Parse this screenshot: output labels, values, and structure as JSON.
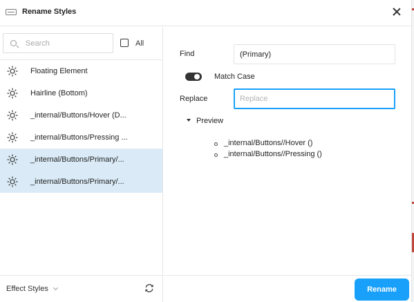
{
  "header": {
    "title": "Rename Styles",
    "icon": "styles-icon"
  },
  "search": {
    "placeholder": "Search",
    "value": ""
  },
  "filter": {
    "all_label": "All",
    "all_checked": false
  },
  "style_list": {
    "items": [
      {
        "label": "Floating Element",
        "icon": "effect-sun-icon",
        "selected": false
      },
      {
        "label": "Hairline (Bottom)",
        "icon": "effect-sun-icon",
        "selected": false
      },
      {
        "label": "_internal/Buttons/Hover (D...",
        "icon": "effect-sun-icon",
        "selected": false
      },
      {
        "label": "_internal/Buttons/Pressing ...",
        "icon": "effect-sun-icon",
        "selected": false
      },
      {
        "label": "_internal/Buttons/Primary/...",
        "icon": "effect-sun-icon",
        "selected": true
      },
      {
        "label": "_internal/Buttons/Primary/...",
        "icon": "effect-sun-icon",
        "selected": true
      }
    ]
  },
  "footer_left": {
    "category": "Effect Styles"
  },
  "form": {
    "find_label": "Find",
    "find_value": "(Primary)",
    "match_case_label": "Match Case",
    "match_case_on": true,
    "replace_label": "Replace",
    "replace_placeholder": "Replace",
    "replace_value": ""
  },
  "preview": {
    "label": "Preview",
    "items": [
      "_internal/Buttons//Hover ()",
      "_internal/Buttons//Pressing ()"
    ]
  },
  "actions": {
    "rename_label": "Rename"
  },
  "colors": {
    "accent": "#18a0fb",
    "selected_row": "#daebf7",
    "toggle_on": "#333333"
  }
}
